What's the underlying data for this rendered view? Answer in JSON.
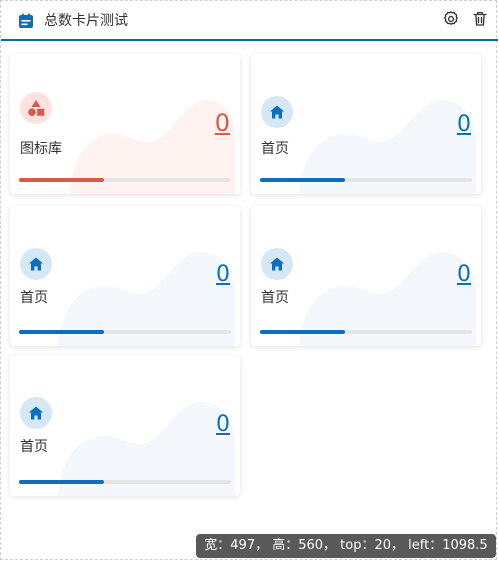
{
  "header": {
    "title": "总数卡片测试",
    "icon": "calendar-icon",
    "actions": [
      {
        "name": "settings-button",
        "icon": "gear-icon"
      },
      {
        "name": "delete-button",
        "icon": "trash-icon"
      }
    ]
  },
  "cards": [
    {
      "label": "图标库",
      "value": "0",
      "icon": "shapes-icon",
      "color": "#d75a4a",
      "bg": "#fde2df",
      "wave": "#fff3f1",
      "progress": 0.4
    },
    {
      "label": "首页",
      "value": "0",
      "icon": "home-icon",
      "color": "#0d6ebf",
      "bg": "#d6e7f5",
      "wave": "#f4f8fc",
      "progress": 0.4
    },
    {
      "label": "首页",
      "value": "0",
      "icon": "home-icon",
      "color": "#0d6ebf",
      "bg": "#d6e7f5",
      "wave": "#f4f8fc",
      "progress": 0.4
    },
    {
      "label": "首页",
      "value": "0",
      "icon": "home-icon",
      "color": "#0d6ebf",
      "bg": "#d6e7f5",
      "wave": "#f4f8fc",
      "progress": 0.4
    },
    {
      "label": "首页",
      "value": "0",
      "icon": "home-icon",
      "color": "#0d6ebf",
      "bg": "#d6e7f5",
      "wave": "#f4f8fc",
      "progress": 0.4
    }
  ],
  "tooltip": "宽：497， 高：560， top：20， left：1098.5",
  "colors": {
    "header_border": "#0d6e8c",
    "track": "#e5e5e5"
  }
}
